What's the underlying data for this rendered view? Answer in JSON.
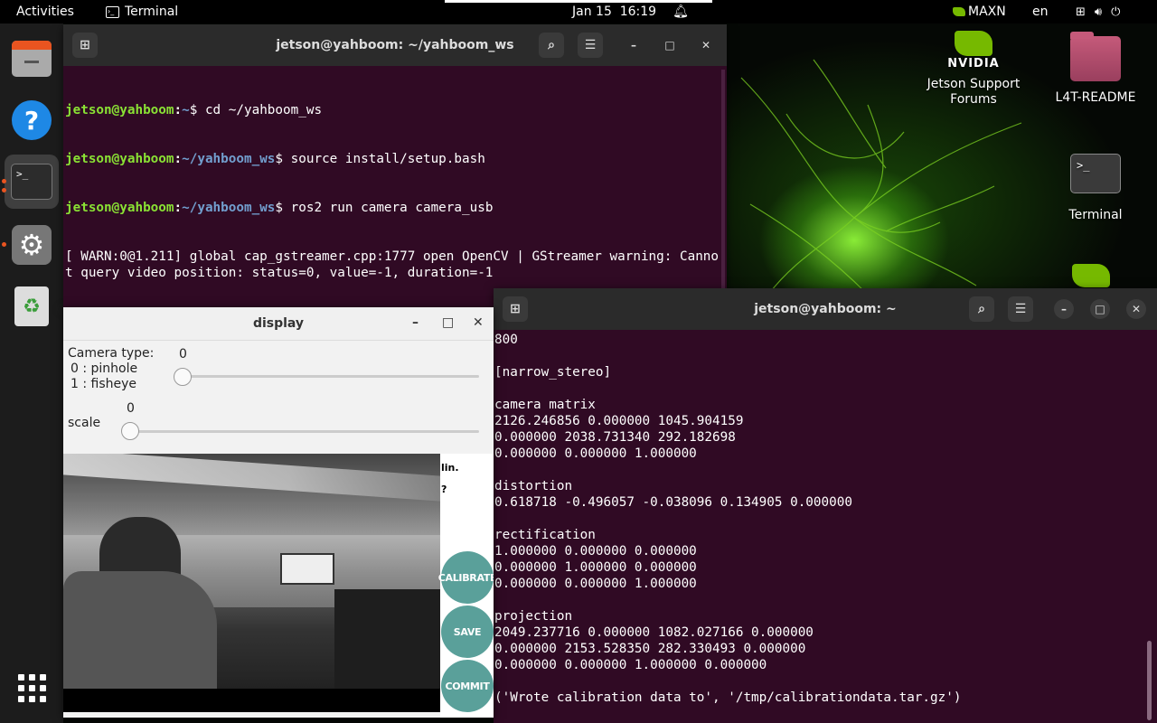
{
  "topbar": {
    "activities": "Activities",
    "app_name": "Terminal",
    "datetime": "Jan 15  16:19",
    "power_mode": "MAXN",
    "language": "en"
  },
  "dock": {
    "items": [
      {
        "name": "files"
      },
      {
        "name": "help"
      },
      {
        "name": "terminal"
      },
      {
        "name": "settings"
      },
      {
        "name": "trash"
      }
    ]
  },
  "desktop": {
    "nvidia_brand": "NVIDIA",
    "icons": [
      {
        "label": "Jetson Support Forums"
      },
      {
        "label": "L4T-README"
      },
      {
        "label": "Terminal"
      }
    ]
  },
  "terminal1": {
    "title": "jetson@yahboom: ~/yahboom_ws",
    "lines": [
      {
        "user": "jetson@yahboom",
        "path": "~",
        "cmd": "$ cd ~/yahboom_ws"
      },
      {
        "user": "jetson@yahboom",
        "path": "~/yahboom_ws",
        "cmd": "$ source install/setup.bash"
      },
      {
        "user": "jetson@yahboom",
        "path": "~/yahboom_ws",
        "cmd": "$ ros2 run camera camera_usb"
      }
    ],
    "warning": "[ WARN:0@1.211] global cap_gstreamer.cpp:1777 open OpenCV | GStreamer warning: Cannot query video position: status=0, value=-1, duration=-1"
  },
  "terminal2": {
    "title": "jetson@yahboom: ~",
    "lines": [
      "800",
      "",
      "[narrow_stereo]",
      "",
      "camera matrix",
      "2126.246856 0.000000 1045.904159",
      "0.000000 2038.731340 292.182698",
      "0.000000 0.000000 1.000000",
      "",
      "distortion",
      "0.618718 -0.496057 -0.038096 0.134905 0.000000",
      "",
      "rectification",
      "1.000000 0.000000 0.000000",
      "0.000000 1.000000 0.000000",
      "0.000000 0.000000 1.000000",
      "",
      "projection",
      "2049.237716 0.000000 1082.027166 0.000000",
      "0.000000 2153.528350 282.330493 0.000000",
      "0.000000 0.000000 1.000000 0.000000",
      "",
      "('Wrote calibration data to', '/tmp/calibrationdata.tar.gz')"
    ]
  },
  "display": {
    "title": "display",
    "camera_type_label": "Camera type:",
    "camera_type_value": "0",
    "camera_type_option0": "0 : pinhole",
    "camera_type_option1": "1 : fisheye",
    "scale_label": "scale",
    "scale_value": "0",
    "side_text1": "lin.",
    "side_text2": "?",
    "calibrate_label": "CALIBRATE",
    "save_label": "SAVE",
    "commit_label": "COMMIT"
  }
}
